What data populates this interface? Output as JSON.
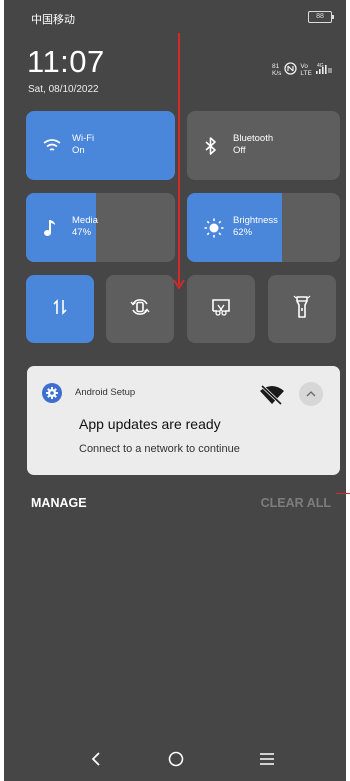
{
  "status_bar": {
    "carrier": "中国移动",
    "battery": "88",
    "net_speed_value": "81",
    "net_speed_unit": "K/s",
    "network_type_top": "Vo",
    "network_type_bottom": "LTE",
    "signal_label": "4G"
  },
  "header": {
    "time": "11:07",
    "date": "Sat, 08/10/2022"
  },
  "tiles": [
    {
      "name": "Wi-Fi",
      "state": "On",
      "active": true
    },
    {
      "name": "Bluetooth",
      "state": "Off",
      "active": false
    },
    {
      "name": "Media",
      "state": "47%",
      "level": 0.47
    },
    {
      "name": "Brightness",
      "state": "62%",
      "level": 0.62
    }
  ],
  "quick_toggles": [
    {
      "icon": "mobile-data-icon",
      "active": true
    },
    {
      "icon": "auto-rotate-icon",
      "active": false
    },
    {
      "icon": "screenshot-icon",
      "active": false
    },
    {
      "icon": "flashlight-icon",
      "active": false
    }
  ],
  "notification": {
    "app_name": "Android Setup",
    "title": "App updates are ready",
    "body": "Connect to a network to continue"
  },
  "actions": {
    "manage": "MANAGE",
    "clear_all": "CLEAR ALL"
  },
  "colors": {
    "panel_bg": "#464646",
    "tile_active": "#4a86d9",
    "tile_inactive": "#5e5e5e",
    "card_bg": "#ececec",
    "annotation": "#d42a2a"
  }
}
